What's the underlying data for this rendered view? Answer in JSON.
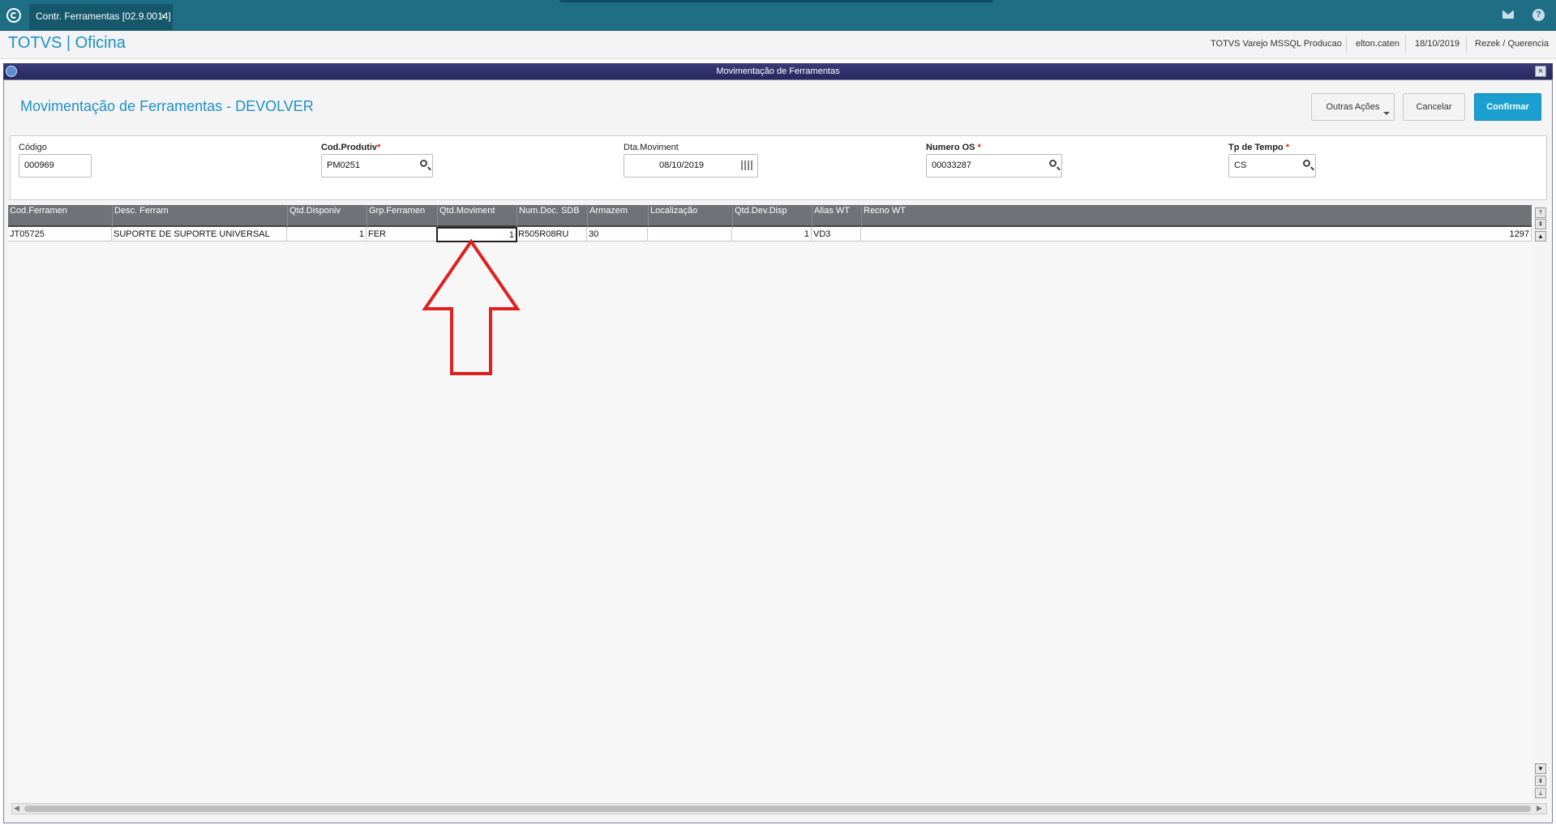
{
  "tab": {
    "title": "Contr. Ferramentas [02.9.0014]",
    "close": "×"
  },
  "topbar": {
    "help": "?"
  },
  "brand": "TOTVS | Oficina",
  "session": {
    "environment": "TOTVS Varejo MSSQL Producao",
    "user": "elton.caten",
    "date": "18/10/2019",
    "company": "Rezek / Querencia"
  },
  "window": {
    "title": "Movimentação de Ferramentas",
    "close": "×"
  },
  "page": {
    "title": "Movimentação de Ferramentas - DEVOLVER"
  },
  "actions": {
    "outras": "Outras Ações",
    "cancel": "Cancelar",
    "confirm": "Confirmar"
  },
  "form": {
    "codigo": {
      "label": "Código",
      "value": "000969"
    },
    "cod_produtiv": {
      "label": "Cod.Produtiv",
      "value": "PM0251"
    },
    "dta_moviment": {
      "label": "Dta.Moviment",
      "value": "08/10/2019"
    },
    "numero_os": {
      "label": "Numero OS",
      "value": "00033287"
    },
    "tp_tempo": {
      "label": "Tp de Tempo",
      "value": "CS"
    },
    "required_mark": "*"
  },
  "grid": {
    "columns": [
      "Cod.Ferramen",
      "Desc. Ferram",
      "Qtd.Disponiv",
      "Grp.Ferramen",
      "Qtd.Moviment",
      "Num.Doc. SDB",
      "Armazem",
      "Localização",
      "Qtd.Dev.Disp",
      "Alias WT",
      "Recno WT"
    ],
    "rows": [
      [
        "JT05725",
        "SUPORTE DE SUPORTE UNIVERSAL",
        "1",
        "FER",
        "1",
        "R505R08RU",
        "30",
        "",
        "1",
        "VD3",
        "1297"
      ]
    ]
  },
  "colors": {
    "accent": "#1e90c9",
    "topbar": "#1e6e86",
    "confirm": "#1a9fd0",
    "annotation_arrow": "#e02020"
  }
}
